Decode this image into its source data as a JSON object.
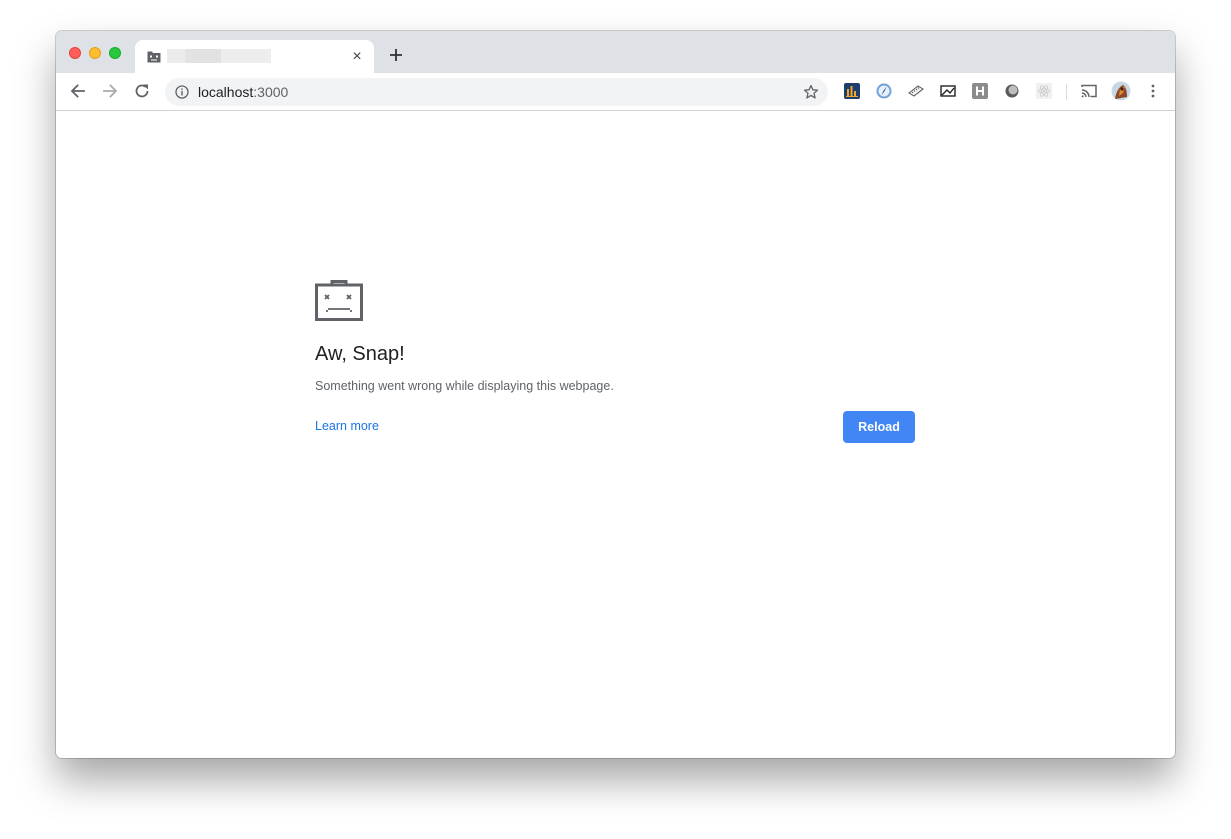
{
  "tab": {
    "title_redacted": true,
    "close_symbol": "×"
  },
  "toolbar": {
    "address": {
      "host": "localhost",
      "port": ":3000"
    }
  },
  "error_page": {
    "title": "Aw, Snap!",
    "description": "Something went wrong while displaying this webpage.",
    "learn_more": "Learn more",
    "reload": "Reload"
  },
  "colors": {
    "accent_button": "#4285f4",
    "link": "#1a73e8",
    "tabstrip": "#dee1e6"
  },
  "icons": {
    "back": "arrow-left-icon",
    "forward": "arrow-right-icon",
    "reload": "refresh-icon",
    "info": "info-icon",
    "bookmark": "star-icon",
    "extensions": [
      "chart-extension-icon",
      "compass-extension-icon",
      "ruler-extension-icon",
      "screenshot-extension-icon",
      "h-extension-icon",
      "circle-extension-icon",
      "react-extension-icon"
    ],
    "cast": "cast-icon",
    "profile": "avatar",
    "menu": "kebab-menu-icon"
  }
}
